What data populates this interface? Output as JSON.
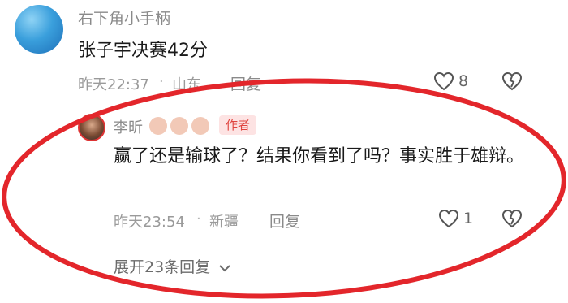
{
  "main_comment": {
    "username": "右下角小手柄",
    "text": "张子宇决赛42分",
    "time": "昨天22:37",
    "location": "山东",
    "reply_label": "回复",
    "likes": "8"
  },
  "reply_comment": {
    "username": "李昕",
    "badge": "作者",
    "text": "赢了还是输球了？结果你看到了吗？事实胜于雄辩。",
    "time": "昨天23:54",
    "location": "新疆",
    "reply_label": "回复",
    "likes": "1"
  },
  "expand": {
    "label": "展开23条回复"
  },
  "colors": {
    "annotation_circle": "#e3262b",
    "author_badge_bg": "#fde3e3",
    "author_badge_text": "#e0443f"
  },
  "icons": {
    "like": "heart-icon",
    "dislike": "broken-heart-icon",
    "expand": "chevron-down-icon"
  }
}
